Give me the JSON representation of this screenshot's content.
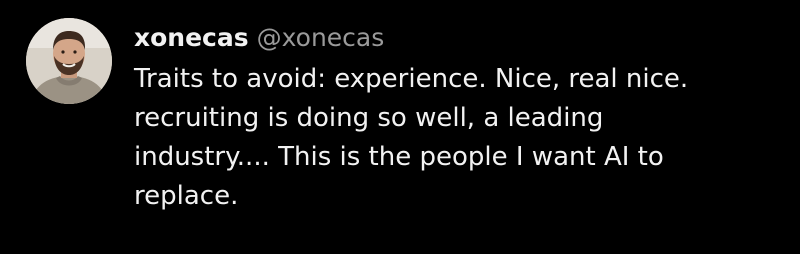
{
  "post": {
    "author": {
      "display_name": "xonecas",
      "handle": "@xonecas",
      "avatar_icon": "user-avatar-photo"
    },
    "text_lines": [
      "Traits to avoid: experience. Nice, real nice.",
      "recruiting is doing so well, a leading",
      "industry.... This is the people I want AI to",
      "replace."
    ]
  },
  "colors": {
    "background": "#000000",
    "primary_text": "#f2f2f2",
    "secondary_text": "#9a9a9a"
  }
}
